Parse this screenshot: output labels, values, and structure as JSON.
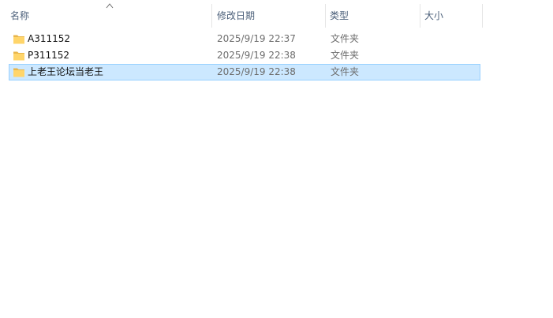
{
  "columns": {
    "name": "名称",
    "date_modified": "修改日期",
    "type": "类型",
    "size": "大小"
  },
  "sort": {
    "column": "name",
    "icon": "sort-ascending-icon"
  },
  "items": [
    {
      "name": "A311152",
      "date_modified": "2025/9/19 22:37",
      "type": "文件夹",
      "size": "",
      "icon": "folder-icon",
      "selected": false
    },
    {
      "name": "P311152",
      "date_modified": "2025/9/19 22:38",
      "type": "文件夹",
      "size": "",
      "icon": "folder-icon",
      "selected": false
    },
    {
      "name": "上老王论坛当老王",
      "date_modified": "2025/9/19 22:38",
      "type": "文件夹",
      "size": "",
      "icon": "folder-icon",
      "selected": true
    }
  ],
  "colors": {
    "selection_bg": "#cce8ff",
    "selection_border": "#99d1ff",
    "header_text": "#4c607a",
    "folder": "#ffd56a"
  }
}
